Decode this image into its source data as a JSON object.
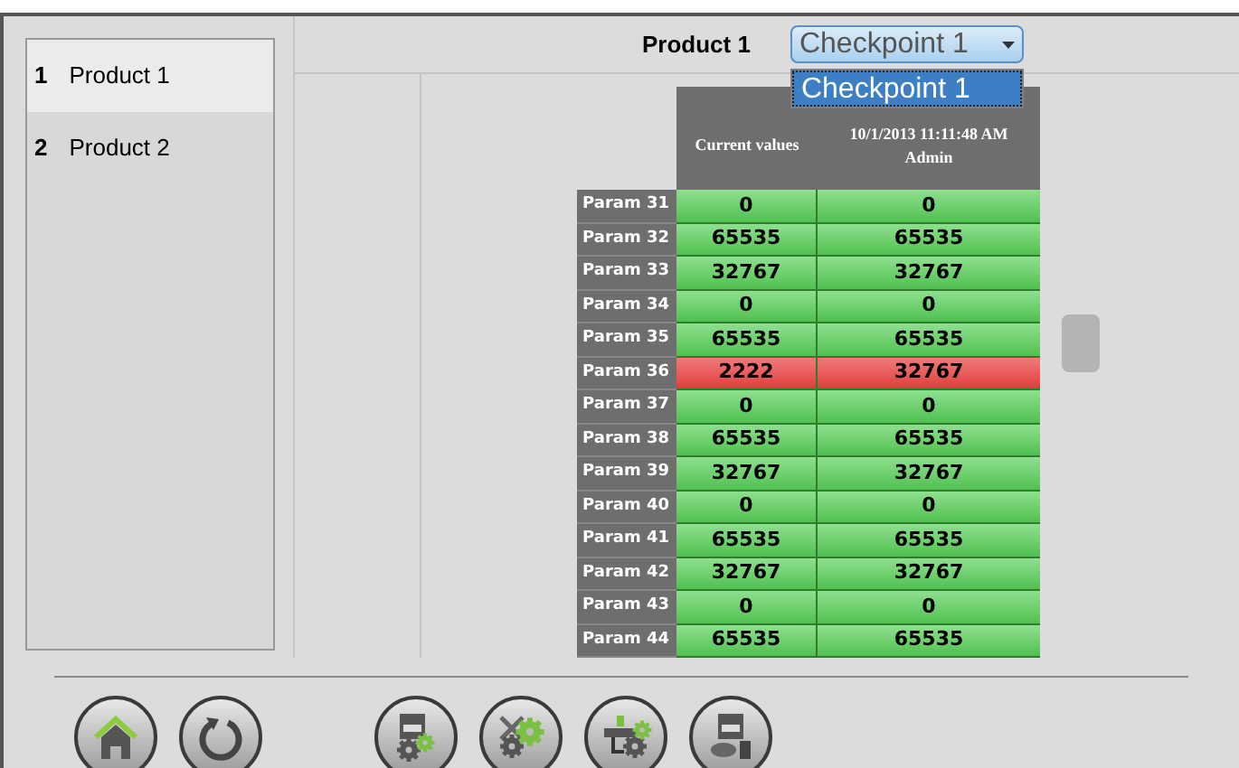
{
  "products": [
    {
      "number": "1",
      "label": "Product 1",
      "selected": true
    },
    {
      "number": "2",
      "label": "Product 2",
      "selected": false
    }
  ],
  "header": {
    "title": "Product 1",
    "dropdown": {
      "value": "Checkpoint 1",
      "expanded": true,
      "options": [
        {
          "label": "Checkpoint 1",
          "selected": true
        }
      ]
    }
  },
  "table": {
    "columns": [
      [
        "Current values"
      ],
      [
        "10/1/2013 11:11:48 AM",
        "Admin"
      ]
    ],
    "rows": [
      {
        "name": "Param 31",
        "current": "0",
        "checkpoint": "0",
        "mismatch": false
      },
      {
        "name": "Param 32",
        "current": "65535",
        "checkpoint": "65535",
        "mismatch": false
      },
      {
        "name": "Param 33",
        "current": "32767",
        "checkpoint": "32767",
        "mismatch": false
      },
      {
        "name": "Param 34",
        "current": "0",
        "checkpoint": "0",
        "mismatch": false
      },
      {
        "name": "Param 35",
        "current": "65535",
        "checkpoint": "65535",
        "mismatch": false
      },
      {
        "name": "Param 36",
        "current": "2222",
        "checkpoint": "32767",
        "mismatch": true
      },
      {
        "name": "Param 37",
        "current": "0",
        "checkpoint": "0",
        "mismatch": false
      },
      {
        "name": "Param 38",
        "current": "65535",
        "checkpoint": "65535",
        "mismatch": false
      },
      {
        "name": "Param 39",
        "current": "32767",
        "checkpoint": "32767",
        "mismatch": false
      },
      {
        "name": "Param 40",
        "current": "0",
        "checkpoint": "0",
        "mismatch": false
      },
      {
        "name": "Param 41",
        "current": "65535",
        "checkpoint": "65535",
        "mismatch": false
      },
      {
        "name": "Param 42",
        "current": "32767",
        "checkpoint": "32767",
        "mismatch": false
      },
      {
        "name": "Param 43",
        "current": "0",
        "checkpoint": "0",
        "mismatch": false
      },
      {
        "name": "Param 44",
        "current": "65535",
        "checkpoint": "65535",
        "mismatch": false
      }
    ]
  }
}
